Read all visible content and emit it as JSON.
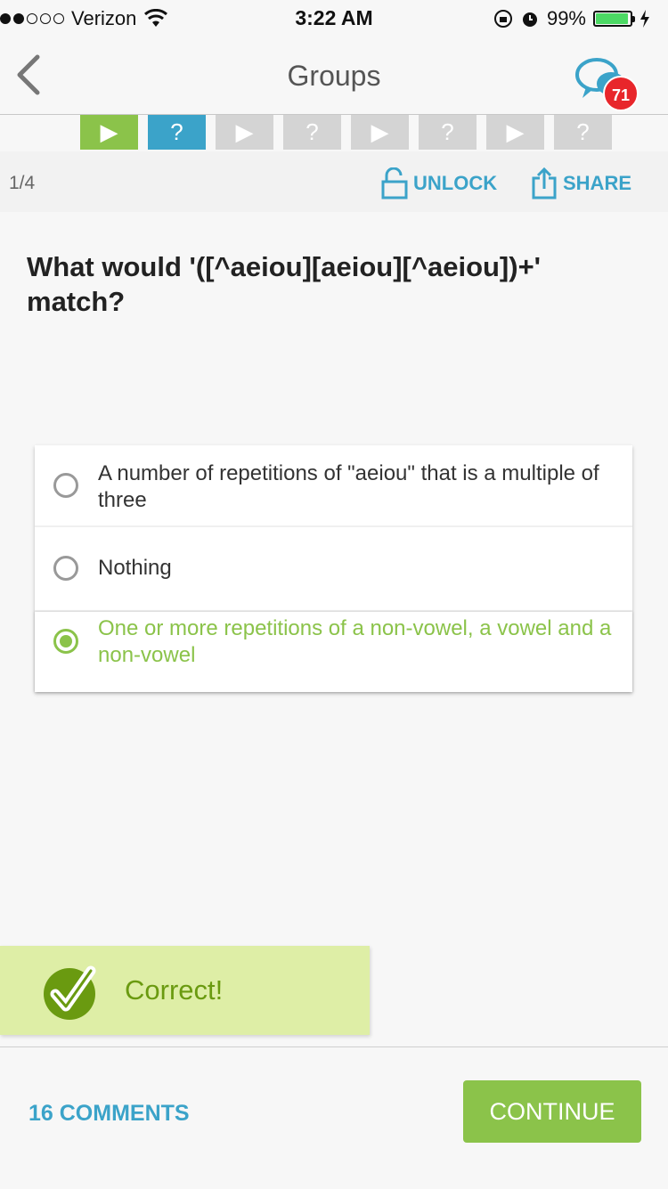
{
  "status": {
    "carrier": "Verizon",
    "time": "3:22 AM",
    "battery": "99%"
  },
  "nav": {
    "title": "Groups",
    "badge_count": "71"
  },
  "progress": {
    "steps": [
      "play",
      "question",
      "play",
      "question",
      "play",
      "question",
      "play",
      "question"
    ],
    "active_steps": 2
  },
  "subbar": {
    "pager": "1/4",
    "unlock_label": "UNLOCK",
    "share_label": "SHARE"
  },
  "question": {
    "text": "What would '([^aeiou][aeiou][^aeiou])+' match?"
  },
  "answers": [
    {
      "text": "A number of repetitions of \"aeiou\" that is a multiple of three",
      "selected": false
    },
    {
      "text": "Nothing",
      "selected": false
    },
    {
      "text": "One or more repetitions of a non-vowel, a vowel and a non-vowel",
      "selected": true
    }
  ],
  "feedback": {
    "label": "Correct!"
  },
  "footer": {
    "comments_label": "16 COMMENTS",
    "continue_label": "CONTINUE"
  },
  "colors": {
    "accent_green": "#8bc34a",
    "accent_blue": "#3ba3c9",
    "badge_red": "#e8262b"
  }
}
